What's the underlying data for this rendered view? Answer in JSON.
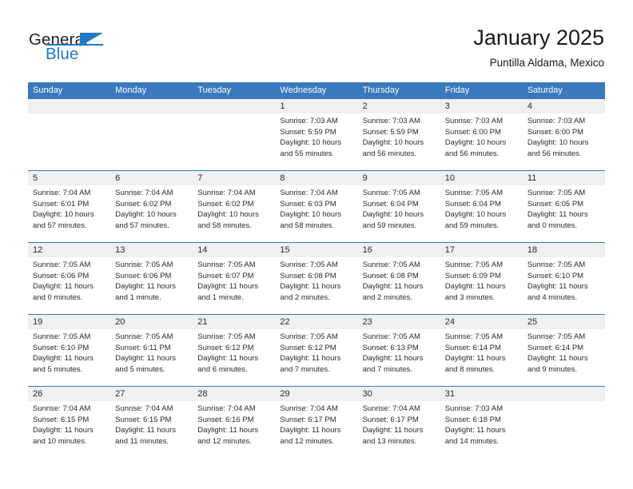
{
  "brand": {
    "name_part1": "General",
    "name_part2": "Blue"
  },
  "header": {
    "title": "January 2025",
    "subtitle": "Puntilla Aldama, Mexico"
  },
  "colors": {
    "header_blue": "#3a79bd",
    "date_band": "#f0f0f0",
    "logo_blue": "#2079c4",
    "text": "#2a2a2a"
  },
  "weekdays": [
    "Sunday",
    "Monday",
    "Tuesday",
    "Wednesday",
    "Thursday",
    "Friday",
    "Saturday"
  ],
  "weeks": [
    {
      "days": [
        {
          "date": "",
          "sunrise": "",
          "sunset": "",
          "daylight_line1": "",
          "daylight_line2": ""
        },
        {
          "date": "",
          "sunrise": "",
          "sunset": "",
          "daylight_line1": "",
          "daylight_line2": ""
        },
        {
          "date": "",
          "sunrise": "",
          "sunset": "",
          "daylight_line1": "",
          "daylight_line2": ""
        },
        {
          "date": "1",
          "sunrise": "Sunrise: 7:03 AM",
          "sunset": "Sunset: 5:59 PM",
          "daylight_line1": "Daylight: 10 hours",
          "daylight_line2": "and 55 minutes."
        },
        {
          "date": "2",
          "sunrise": "Sunrise: 7:03 AM",
          "sunset": "Sunset: 5:59 PM",
          "daylight_line1": "Daylight: 10 hours",
          "daylight_line2": "and 56 minutes."
        },
        {
          "date": "3",
          "sunrise": "Sunrise: 7:03 AM",
          "sunset": "Sunset: 6:00 PM",
          "daylight_line1": "Daylight: 10 hours",
          "daylight_line2": "and 56 minutes."
        },
        {
          "date": "4",
          "sunrise": "Sunrise: 7:03 AM",
          "sunset": "Sunset: 6:00 PM",
          "daylight_line1": "Daylight: 10 hours",
          "daylight_line2": "and 56 minutes."
        }
      ]
    },
    {
      "days": [
        {
          "date": "5",
          "sunrise": "Sunrise: 7:04 AM",
          "sunset": "Sunset: 6:01 PM",
          "daylight_line1": "Daylight: 10 hours",
          "daylight_line2": "and 57 minutes."
        },
        {
          "date": "6",
          "sunrise": "Sunrise: 7:04 AM",
          "sunset": "Sunset: 6:02 PM",
          "daylight_line1": "Daylight: 10 hours",
          "daylight_line2": "and 57 minutes."
        },
        {
          "date": "7",
          "sunrise": "Sunrise: 7:04 AM",
          "sunset": "Sunset: 6:02 PM",
          "daylight_line1": "Daylight: 10 hours",
          "daylight_line2": "and 58 minutes."
        },
        {
          "date": "8",
          "sunrise": "Sunrise: 7:04 AM",
          "sunset": "Sunset: 6:03 PM",
          "daylight_line1": "Daylight: 10 hours",
          "daylight_line2": "and 58 minutes."
        },
        {
          "date": "9",
          "sunrise": "Sunrise: 7:05 AM",
          "sunset": "Sunset: 6:04 PM",
          "daylight_line1": "Daylight: 10 hours",
          "daylight_line2": "and 59 minutes."
        },
        {
          "date": "10",
          "sunrise": "Sunrise: 7:05 AM",
          "sunset": "Sunset: 6:04 PM",
          "daylight_line1": "Daylight: 10 hours",
          "daylight_line2": "and 59 minutes."
        },
        {
          "date": "11",
          "sunrise": "Sunrise: 7:05 AM",
          "sunset": "Sunset: 6:05 PM",
          "daylight_line1": "Daylight: 11 hours",
          "daylight_line2": "and 0 minutes."
        }
      ]
    },
    {
      "days": [
        {
          "date": "12",
          "sunrise": "Sunrise: 7:05 AM",
          "sunset": "Sunset: 6:06 PM",
          "daylight_line1": "Daylight: 11 hours",
          "daylight_line2": "and 0 minutes."
        },
        {
          "date": "13",
          "sunrise": "Sunrise: 7:05 AM",
          "sunset": "Sunset: 6:06 PM",
          "daylight_line1": "Daylight: 11 hours",
          "daylight_line2": "and 1 minute."
        },
        {
          "date": "14",
          "sunrise": "Sunrise: 7:05 AM",
          "sunset": "Sunset: 6:07 PM",
          "daylight_line1": "Daylight: 11 hours",
          "daylight_line2": "and 1 minute."
        },
        {
          "date": "15",
          "sunrise": "Sunrise: 7:05 AM",
          "sunset": "Sunset: 6:08 PM",
          "daylight_line1": "Daylight: 11 hours",
          "daylight_line2": "and 2 minutes."
        },
        {
          "date": "16",
          "sunrise": "Sunrise: 7:05 AM",
          "sunset": "Sunset: 6:08 PM",
          "daylight_line1": "Daylight: 11 hours",
          "daylight_line2": "and 2 minutes."
        },
        {
          "date": "17",
          "sunrise": "Sunrise: 7:05 AM",
          "sunset": "Sunset: 6:09 PM",
          "daylight_line1": "Daylight: 11 hours",
          "daylight_line2": "and 3 minutes."
        },
        {
          "date": "18",
          "sunrise": "Sunrise: 7:05 AM",
          "sunset": "Sunset: 6:10 PM",
          "daylight_line1": "Daylight: 11 hours",
          "daylight_line2": "and 4 minutes."
        }
      ]
    },
    {
      "days": [
        {
          "date": "19",
          "sunrise": "Sunrise: 7:05 AM",
          "sunset": "Sunset: 6:10 PM",
          "daylight_line1": "Daylight: 11 hours",
          "daylight_line2": "and 5 minutes."
        },
        {
          "date": "20",
          "sunrise": "Sunrise: 7:05 AM",
          "sunset": "Sunset: 6:11 PM",
          "daylight_line1": "Daylight: 11 hours",
          "daylight_line2": "and 5 minutes."
        },
        {
          "date": "21",
          "sunrise": "Sunrise: 7:05 AM",
          "sunset": "Sunset: 6:12 PM",
          "daylight_line1": "Daylight: 11 hours",
          "daylight_line2": "and 6 minutes."
        },
        {
          "date": "22",
          "sunrise": "Sunrise: 7:05 AM",
          "sunset": "Sunset: 6:12 PM",
          "daylight_line1": "Daylight: 11 hours",
          "daylight_line2": "and 7 minutes."
        },
        {
          "date": "23",
          "sunrise": "Sunrise: 7:05 AM",
          "sunset": "Sunset: 6:13 PM",
          "daylight_line1": "Daylight: 11 hours",
          "daylight_line2": "and 7 minutes."
        },
        {
          "date": "24",
          "sunrise": "Sunrise: 7:05 AM",
          "sunset": "Sunset: 6:14 PM",
          "daylight_line1": "Daylight: 11 hours",
          "daylight_line2": "and 8 minutes."
        },
        {
          "date": "25",
          "sunrise": "Sunrise: 7:05 AM",
          "sunset": "Sunset: 6:14 PM",
          "daylight_line1": "Daylight: 11 hours",
          "daylight_line2": "and 9 minutes."
        }
      ]
    },
    {
      "days": [
        {
          "date": "26",
          "sunrise": "Sunrise: 7:04 AM",
          "sunset": "Sunset: 6:15 PM",
          "daylight_line1": "Daylight: 11 hours",
          "daylight_line2": "and 10 minutes."
        },
        {
          "date": "27",
          "sunrise": "Sunrise: 7:04 AM",
          "sunset": "Sunset: 6:15 PM",
          "daylight_line1": "Daylight: 11 hours",
          "daylight_line2": "and 11 minutes."
        },
        {
          "date": "28",
          "sunrise": "Sunrise: 7:04 AM",
          "sunset": "Sunset: 6:16 PM",
          "daylight_line1": "Daylight: 11 hours",
          "daylight_line2": "and 12 minutes."
        },
        {
          "date": "29",
          "sunrise": "Sunrise: 7:04 AM",
          "sunset": "Sunset: 6:17 PM",
          "daylight_line1": "Daylight: 11 hours",
          "daylight_line2": "and 12 minutes."
        },
        {
          "date": "30",
          "sunrise": "Sunrise: 7:04 AM",
          "sunset": "Sunset: 6:17 PM",
          "daylight_line1": "Daylight: 11 hours",
          "daylight_line2": "and 13 minutes."
        },
        {
          "date": "31",
          "sunrise": "Sunrise: 7:03 AM",
          "sunset": "Sunset: 6:18 PM",
          "daylight_line1": "Daylight: 11 hours",
          "daylight_line2": "and 14 minutes."
        },
        {
          "date": "",
          "sunrise": "",
          "sunset": "",
          "daylight_line1": "",
          "daylight_line2": ""
        }
      ]
    }
  ]
}
